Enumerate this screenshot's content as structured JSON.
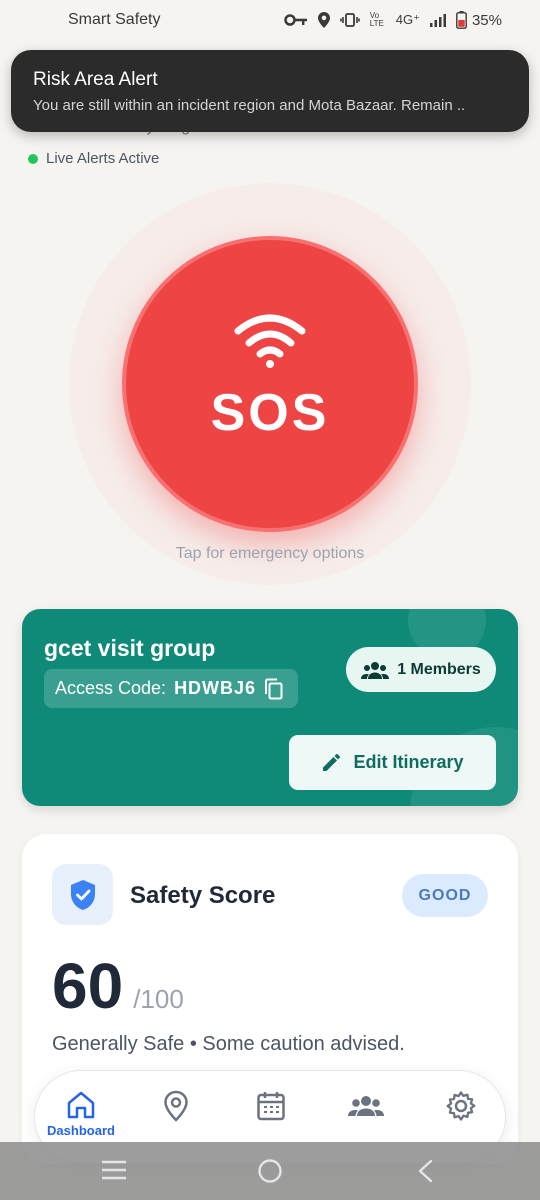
{
  "status_bar": {
    "app_name": "Smart Safety",
    "network": "4G⁺",
    "volte": "Vo LTE",
    "battery": "35%"
  },
  "location": {
    "text": "Near Vallabh Vidyanagar 01 388120 Anand India"
  },
  "live_alerts": {
    "label": "Live Alerts Active",
    "color": "#22c55e"
  },
  "toast": {
    "title": "Risk Area Alert",
    "message": "You are still within an incident region and Mota Bazaar. Remain .."
  },
  "sos": {
    "label": "SOS",
    "hint": "Tap for emergency options",
    "color": "#ef4444",
    "icon": "wifi-signal-icon"
  },
  "group": {
    "name": "gcet visit group",
    "access_label": "Access Code:",
    "access_code": "HDWBJ6",
    "members": "1 Members",
    "edit_label": "Edit Itinerary",
    "color": "#0f8a78"
  },
  "safety": {
    "title": "Safety Score",
    "badge": "GOOD",
    "score": "60",
    "max": "/100",
    "description": "Generally Safe • Some caution advised.",
    "score_value": 60
  },
  "nav": {
    "items": [
      {
        "label": "Dashboard",
        "icon": "home-icon",
        "active": true
      },
      {
        "label": "",
        "icon": "location-pin-icon"
      },
      {
        "label": "",
        "icon": "calendar-icon"
      },
      {
        "label": "",
        "icon": "group-icon"
      },
      {
        "label": "",
        "icon": "gear-icon"
      }
    ],
    "accent": "#2563eb"
  }
}
